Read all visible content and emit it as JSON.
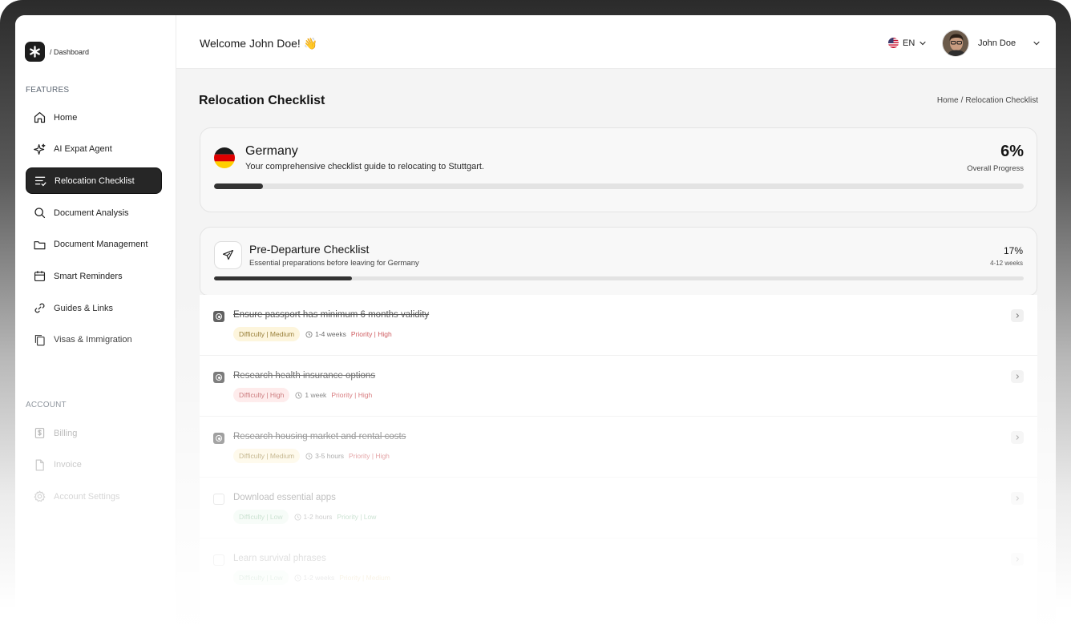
{
  "brand": {
    "breadcrumb": "/ Dashboard"
  },
  "sidebar": {
    "features_label": "FEATURES",
    "features": [
      {
        "label": "Home",
        "icon": "home-icon"
      },
      {
        "label": "AI Expat Agent",
        "icon": "sparkle-icon"
      },
      {
        "label": "Relocation Checklist",
        "icon": "checklist-icon",
        "active": true
      },
      {
        "label": "Document Analysis",
        "icon": "search-icon"
      },
      {
        "label": "Document Management",
        "icon": "folder-icon"
      },
      {
        "label": "Smart Reminders",
        "icon": "calendar-icon"
      },
      {
        "label": "Guides & Links",
        "icon": "link-icon"
      },
      {
        "label": "Visas & Immigration",
        "icon": "copy-icon"
      }
    ],
    "account_label": "ACCOUNT",
    "account": [
      {
        "label": "Billing",
        "icon": "dollar-icon"
      },
      {
        "label": "Invoice",
        "icon": "file-icon"
      },
      {
        "label": "Account Settings",
        "icon": "gear-icon"
      }
    ]
  },
  "header": {
    "welcome": "Welcome John Doe! 👋",
    "language": "EN",
    "user_name": "John Doe"
  },
  "page": {
    "title": "Relocation Checklist",
    "breadcrumb_home": "Home",
    "breadcrumb_sep": "/",
    "breadcrumb_current": "Relocation Checklist"
  },
  "country": {
    "name": "Germany",
    "subtitle": "Your comprehensive checklist guide to relocating to Stuttgart.",
    "progress_text": "6%",
    "progress_label": "Overall Progress",
    "progress_value": 0.06
  },
  "pre_departure": {
    "title": "Pre-Departure Checklist",
    "subtitle": "Essential preparations before leaving for Germany",
    "progress_text": "17%",
    "duration": "4-12 weeks",
    "progress_value": 0.17
  },
  "items": [
    {
      "title": "Ensure passport has minimum 6 months validity",
      "done": true,
      "difficulty": "Difficulty | Medium",
      "diff_level": "med",
      "duration": "1-4 weeks",
      "priority": "Priority | High",
      "prio_level": "high"
    },
    {
      "title": "Research health insurance options",
      "done": true,
      "difficulty": "Difficulty | High",
      "diff_level": "high",
      "duration": "1 week",
      "priority": "Priority | High",
      "prio_level": "high"
    },
    {
      "title": "Research housing market and rental costs",
      "done": true,
      "difficulty": "Difficulty | Medium",
      "diff_level": "med",
      "duration": "3-5 hours",
      "priority": "Priority | High",
      "prio_level": "high"
    },
    {
      "title": "Download essential apps",
      "done": false,
      "difficulty": "Difficulty | Low",
      "diff_level": "low",
      "duration": "1-2 hours",
      "priority": "Priority | Low",
      "prio_level": "low"
    },
    {
      "title": "Learn survival phrases",
      "done": false,
      "difficulty": "Difficulty | Low",
      "diff_level": "low",
      "duration": "1-2 weeks",
      "priority": "Priority | Medium",
      "prio_level": "med"
    }
  ],
  "colors": {
    "accent": "#262626",
    "high": "#c8454a",
    "medium": "#c99a2a",
    "low": "#4a9a62"
  }
}
